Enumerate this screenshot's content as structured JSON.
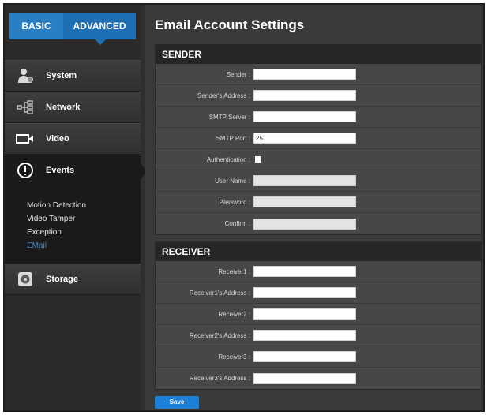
{
  "tabs": {
    "basic": "BASIC",
    "advanced": "ADVANCED"
  },
  "nav": {
    "system": "System",
    "network": "Network",
    "video": "Video",
    "events": "Events",
    "storage": "Storage"
  },
  "events_submenu": [
    "Motion Detection",
    "Video Tamper",
    "Exception",
    "EMail"
  ],
  "page_title": "Email Account Settings",
  "sender": {
    "header": "SENDER",
    "sender_label": "Sender :",
    "sender_value": "",
    "address_label": "Sender's Address :",
    "address_value": "",
    "smtp_server_label": "SMTP Server :",
    "smtp_server_value": "",
    "smtp_port_label": "SMTP Port :",
    "smtp_port_value": "25",
    "auth_label": "Authentication :",
    "auth_checked": false,
    "username_label": "User Name :",
    "username_value": "",
    "password_label": "Password :",
    "password_value": "",
    "confirm_label": "Confirm :",
    "confirm_value": ""
  },
  "receiver": {
    "header": "RECEIVER",
    "r1_label": "Receiver1 :",
    "r1_addr_label": "Receiver1's Address :",
    "r2_label": "Receiver2 :",
    "r2_addr_label": "Receiver2's Address :",
    "r3_label": "Receiver3 :",
    "r3_addr_label": "Receiver3's Address :"
  },
  "save_label": "Save",
  "colors": {
    "accent": "#1e6fb3",
    "basic_tab": "#2a7fc2",
    "active_link": "#3a8ad6",
    "save_button": "#1e7fd6"
  },
  "icons": {
    "system": "user-gear-icon",
    "network": "network-tree-icon",
    "video": "camera-icon",
    "events": "alert-circle-icon",
    "storage": "disk-icon"
  }
}
